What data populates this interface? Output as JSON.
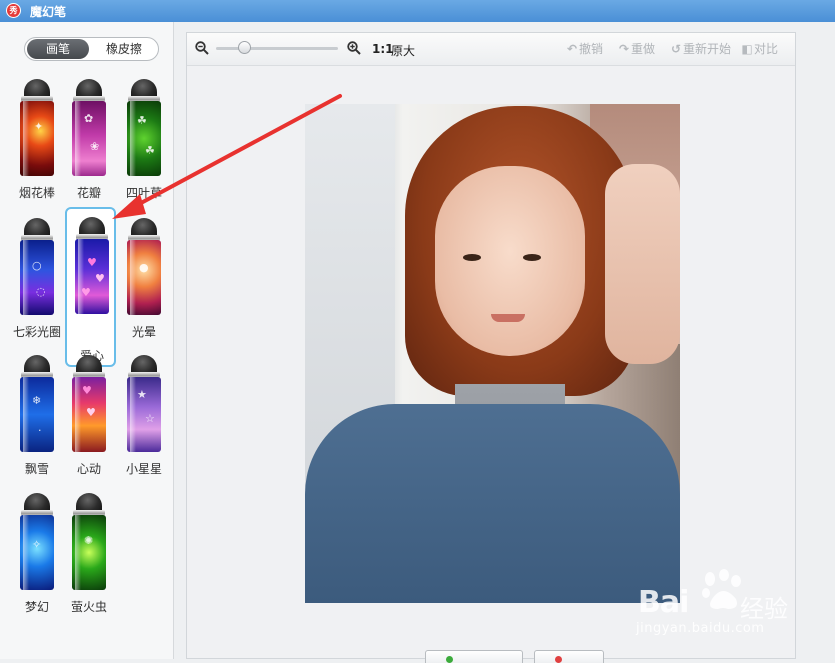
{
  "window": {
    "app_logo_text": "秀",
    "title": "魔幻笔"
  },
  "mode_switch": {
    "brush_label": "画笔",
    "eraser_label": "橡皮擦",
    "active": "画笔"
  },
  "brushes": [
    {
      "label": "烟花棒",
      "selected": false
    },
    {
      "label": "花瓣",
      "selected": false
    },
    {
      "label": "四叶草",
      "selected": false
    },
    {
      "label": "七彩光圈",
      "selected": false
    },
    {
      "label": "爱心",
      "selected": true
    },
    {
      "label": "光晕",
      "selected": false
    },
    {
      "label": "飘雪",
      "selected": false
    },
    {
      "label": "心动",
      "selected": false
    },
    {
      "label": "小星星",
      "selected": false
    },
    {
      "label": "梦幻",
      "selected": false
    },
    {
      "label": "萤火虫",
      "selected": false
    }
  ],
  "toolbar": {
    "zoom_ratio": "1:1",
    "original_size": "原大",
    "undo": "撤销",
    "redo": "重做",
    "restart": "重新开始",
    "compare": "对比",
    "zoom_level": 0.2
  },
  "watermark": {
    "brand": "Bai",
    "brand_cn": "经验",
    "url": "jingyan.baidu.com"
  },
  "colors": {
    "titlebar": "#5a9de0",
    "selection_border": "#69bde9",
    "arrow": "#e8322f"
  }
}
